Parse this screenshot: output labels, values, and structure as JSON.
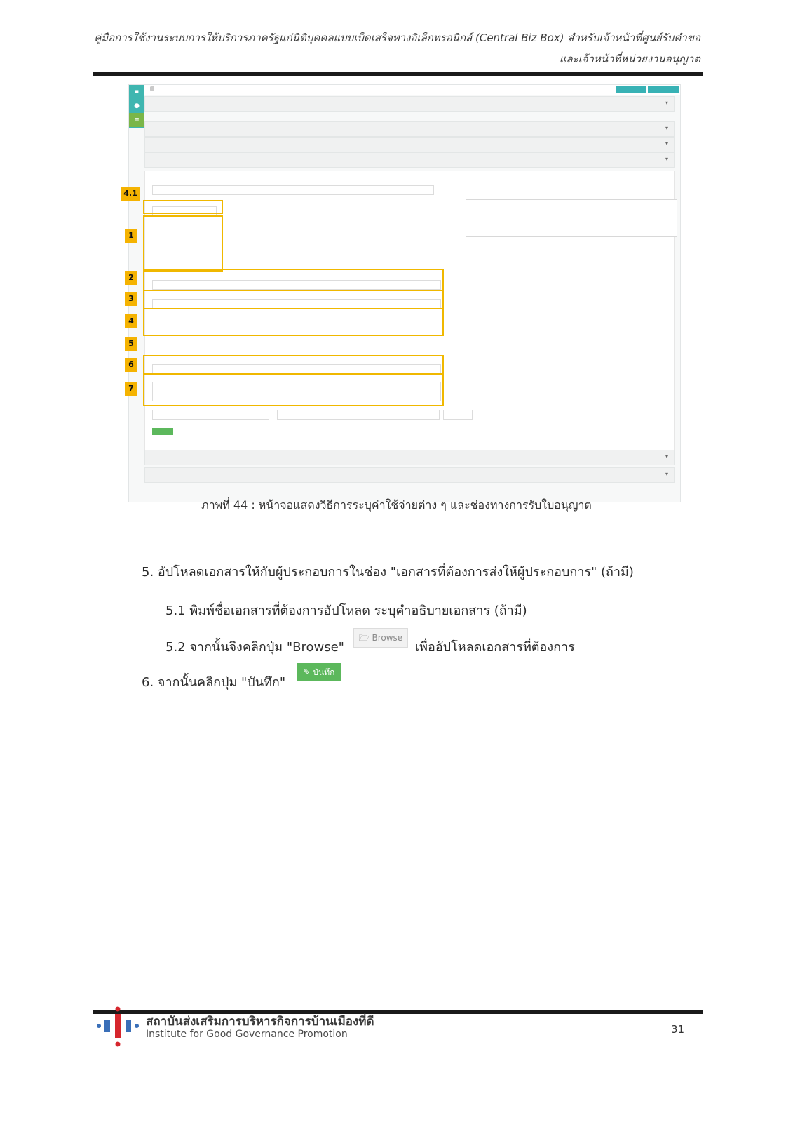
{
  "header": {
    "line1": "คู่มือการใช้งานระบบการให้บริการภาครัฐแก่นิติบุคคลแบบเบ็ดเสร็จทางอิเล็กทรอนิกส์ (Central Biz Box) สำหรับเจ้าหน้าที่ศูนย์รับคำขอ",
    "line2": "และเจ้าหน้าที่หน่วยงานอนุญาต"
  },
  "figure": {
    "markers": [
      "4.1",
      "1",
      "2",
      "3",
      "4",
      "5",
      "6",
      "7"
    ],
    "caption": "ภาพที่ 44 : หน้าจอแสดงวิธีการระบุค่าใช้จ่ายต่าง ๆ และช่องทางการรับใบอนุญาต"
  },
  "steps": {
    "s5": "5. อัปโหลดเอกสารให้กับผู้ประกอบการในช่อง \"เอกสารที่ต้องการส่งให้ผู้ประกอบการ\" (ถ้ามี)",
    "s5_1": "5.1 พิมพ์ชื่อเอกสารที่ต้องการอัปโหลด ระบุคำอธิบายเอกสาร (ถ้ามี)",
    "s5_2_before": "5.2 จากนั้นจึงคลิกปุ่ม \"Browse\"",
    "browse_label": "Browse",
    "s5_2_after": "เพื่ออัปโหลดเอกสารที่ต้องการ",
    "s6": "6. จากนั้นคลิกปุ่ม \"บันทึก\"",
    "save_label": "บันทึก"
  },
  "footer": {
    "org_th": "สถาบันส่งเสริมการบริหารกิจการบ้านเมืองที่ดี",
    "org_en": "Institute for Good Governance Promotion",
    "page_number": "31"
  }
}
